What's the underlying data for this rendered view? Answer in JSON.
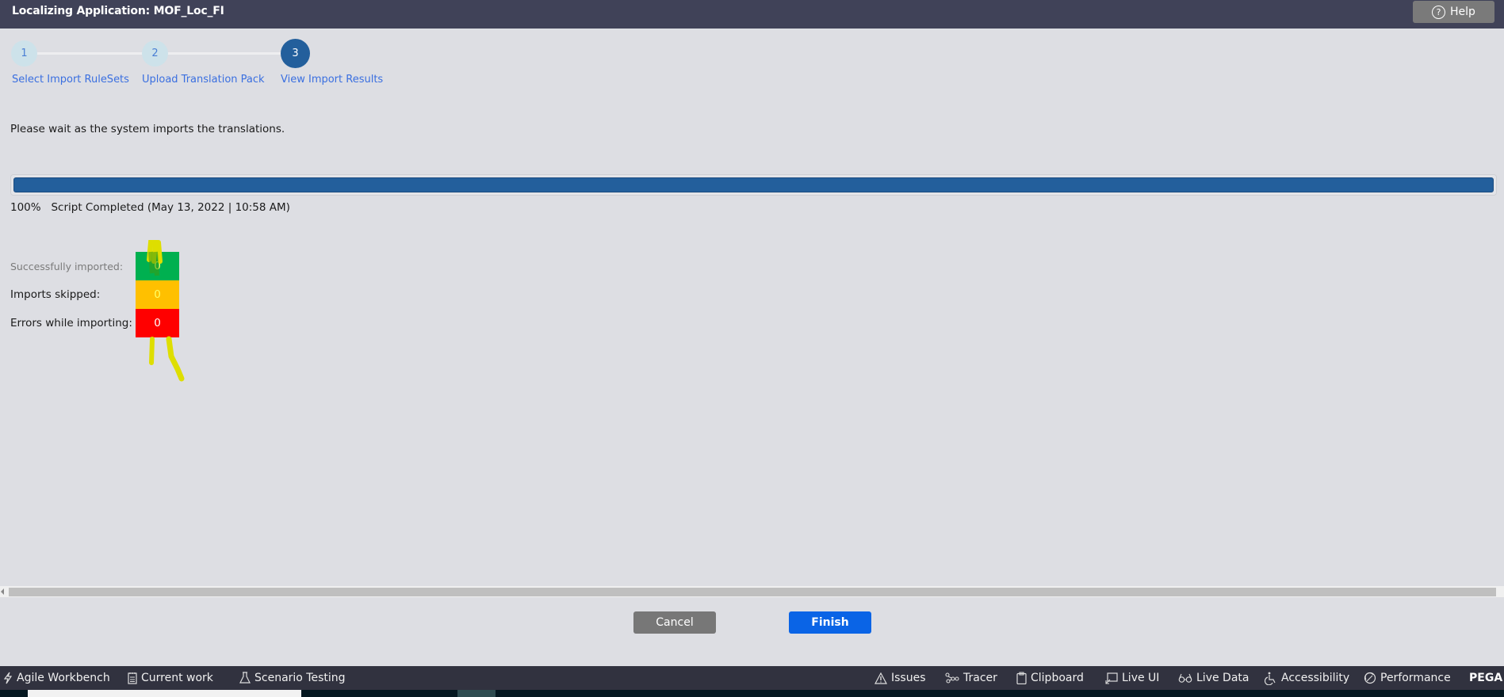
{
  "header": {
    "title": "Localizing Application: MOF_Loc_FI",
    "help_label": "Help"
  },
  "wizard": {
    "current_step": 3,
    "steps": [
      {
        "number": "1",
        "label": "Select Import RuleSets",
        "state": "completed"
      },
      {
        "number": "2",
        "label": "Upload Translation Pack",
        "state": "completed"
      },
      {
        "number": "3",
        "label": "View Import Results",
        "state": "active"
      }
    ]
  },
  "status": {
    "message": "Please wait as the system imports the translations.",
    "progress_percent": 100,
    "progress_label": "100%",
    "progress_status": "Script Completed (May 13, 2022 | 10:58 AM)"
  },
  "results": [
    {
      "label": "Successfully imported:",
      "value": "0",
      "color": "#00b050",
      "text_color": "#ffff66"
    },
    {
      "label": "Imports skipped:",
      "value": "0",
      "color": "#ffc000",
      "text_color": "#ffff66"
    },
    {
      "label": "Errors while importing:",
      "value": "0",
      "color": "#ff0000",
      "text_color": "#ffffff"
    }
  ],
  "actions": {
    "cancel_label": "Cancel",
    "finish_label": "Finish"
  },
  "devbar": {
    "left": [
      {
        "label": "Agile Workbench",
        "icon": "lightning-icon"
      },
      {
        "label": "Current work",
        "icon": "notepad-icon"
      },
      {
        "label": "Scenario Testing",
        "icon": "flask-icon"
      }
    ],
    "right": [
      {
        "label": "Issues",
        "icon": "warning-icon"
      },
      {
        "label": "Tracer",
        "icon": "tracer-icon"
      },
      {
        "label": "Clipboard",
        "icon": "clipboard-icon"
      },
      {
        "label": "Live UI",
        "icon": "live-ui-icon"
      },
      {
        "label": "Live Data",
        "icon": "glasses-icon"
      },
      {
        "label": "Accessibility",
        "icon": "accessibility-icon"
      },
      {
        "label": "Performance",
        "icon": "gauge-icon"
      }
    ],
    "brand": "PEGA"
  },
  "colors": {
    "header_bg": "#404258",
    "step_active": "#235f9c",
    "progress_fill": "#235f9c",
    "finish_button": "#0a64e6",
    "cancel_button": "#777777",
    "annotation": "#e0e000"
  }
}
